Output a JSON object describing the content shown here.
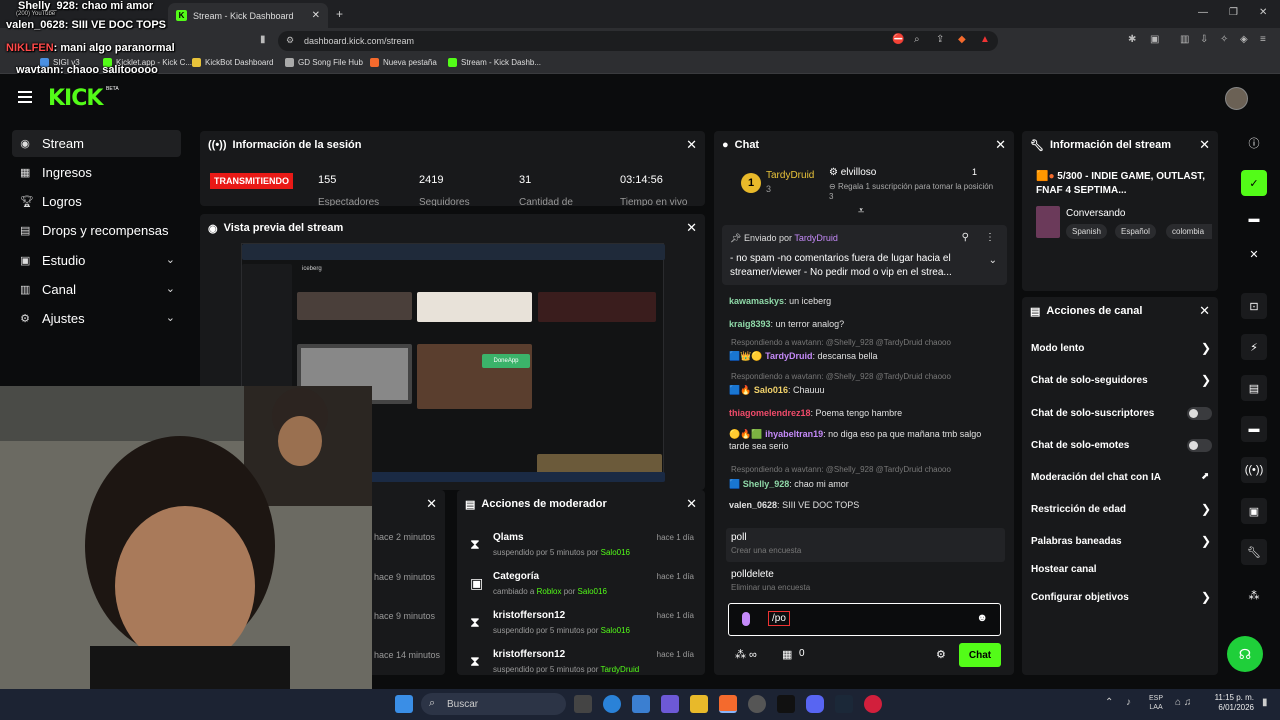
{
  "browser": {
    "tab_title": "Stream - Kick Dashboard",
    "url": "dashboard.kick.com/stream",
    "bookmarks": [
      "SIGI v3",
      "Kicklet.app - Kick C...",
      "KickBot Dashboard",
      "GD Song File Hub",
      "Nueva pestaña",
      "Stream - Kick Dashb..."
    ]
  },
  "overlay_chat": [
    {
      "user": "Shelly_928",
      "text": "chao mi amor",
      "sub": "(200) YouTube"
    },
    {
      "user": "valen_0628",
      "text": "SIII VE DOC TOPS"
    },
    {
      "user": "NIKLFEN",
      "text": "mani algo paranormal"
    },
    {
      "user": "wavtann",
      "text": "chaoo salitooooo"
    }
  ],
  "header": {
    "logo": "KICK",
    "beta": "BETA"
  },
  "sidebar": {
    "items": [
      {
        "label": "Stream",
        "icon": "stream-icon"
      },
      {
        "label": "Ingresos",
        "icon": "revenue-icon"
      },
      {
        "label": "Logros",
        "icon": "trophy-icon"
      },
      {
        "label": "Drops y recompensas",
        "icon": "gift-icon"
      },
      {
        "label": "Estudio",
        "icon": "studio-icon"
      },
      {
        "label": "Canal",
        "icon": "channel-icon"
      },
      {
        "label": "Ajustes",
        "icon": "gear-icon"
      }
    ]
  },
  "session": {
    "title": "Información de la sesión",
    "live_badge": "TRANSMITIENDO",
    "stats": [
      {
        "value": "155",
        "label": "Espectadores"
      },
      {
        "value": "2419",
        "label": "Seguidores"
      },
      {
        "value": "31",
        "label": "Cantidad de"
      },
      {
        "value": "03:14:56",
        "label": "Tiempo en vivo"
      }
    ]
  },
  "preview": {
    "title": "Vista previa del stream",
    "inner_labels": [
      "iceberg",
      "DoneApp"
    ]
  },
  "chat": {
    "title": "Chat",
    "leader": {
      "name": "TardyDruid",
      "rank": "1",
      "sub_count": "3"
    },
    "gifter": {
      "name": "elvilloso",
      "count": "1",
      "desc": "Regala 1 suscripción para tomar la posición 3"
    },
    "pinned": {
      "sent_by": "Enviado por",
      "user": "TardyDruid",
      "text": "- no spam -no comentarios fuera de lugar hacia el streamer/viewer - No pedir mod o vip en el strea..."
    },
    "messages": [
      {
        "user": "kawamaskys",
        "text": "un iceberg",
        "color": "#8fd9a8"
      },
      {
        "user": "kraig8393",
        "text": "un terror analog?",
        "color": "#8fd9a8"
      },
      {
        "reply": "Respondiendo a wavtann: @Shelly_928 @TardyDruid chaooo",
        "user": "TardyDruid",
        "text": "descansa bella",
        "color": "#c58af9"
      },
      {
        "reply": "Respondiendo a wavtann: @Shelly_928 @TardyDruid chaooo",
        "user": "Salo016",
        "text": "Chauuu",
        "color": "#f3d36b"
      },
      {
        "user": "thiagomelendrez18",
        "text": "Poema tengo hambre",
        "color": "#f04b6a"
      },
      {
        "user": "ihyabeltran19",
        "text": "no diga eso pa que mañana tmb salgo tarde sea serio",
        "color": "#c58af9"
      },
      {
        "reply": "Respondiendo a wavtann: @Shelly_928 @TardyDruid chaooo",
        "user": "Shelly_928",
        "text": "chao mi amor",
        "color": "#8fd9a8"
      },
      {
        "user": "valen_0628",
        "text": "SIII VE DOC TOPS",
        "color": "#e8e8e8"
      }
    ],
    "suggestions": [
      {
        "cmd": "poll",
        "desc": "Crear una encuesta"
      },
      {
        "cmd": "polldelete",
        "desc": "Eliminar una encuesta"
      }
    ],
    "input_value": "/po",
    "send_label": "Chat",
    "points": "0"
  },
  "stream_info": {
    "title": "Información del stream",
    "stream_title": "5/300 - INDIE GAME, OUTLAST, FNAF 4 SEPTIMA...",
    "category": "Conversando",
    "tags": [
      "Spanish",
      "Español",
      "colombia"
    ]
  },
  "channel_actions": {
    "title": "Acciones de canal",
    "items": [
      {
        "label": "Modo lento",
        "control": "arrow"
      },
      {
        "label": "Chat de solo-seguidores",
        "control": "arrow"
      },
      {
        "label": "Chat de solo-suscriptores",
        "control": "toggle"
      },
      {
        "label": "Chat de solo-emotes",
        "control": "toggle"
      },
      {
        "label": "Moderación del chat con IA",
        "control": "external"
      },
      {
        "label": "Restricción de edad",
        "control": "arrow"
      },
      {
        "label": "Palabras baneadas",
        "control": "arrow"
      },
      {
        "label": "Hostear canal",
        "control": "none"
      },
      {
        "label": "Configurar objetivos",
        "control": "arrow"
      }
    ]
  },
  "mod_actions": {
    "title": "Acciones de moderador",
    "items": [
      {
        "name": "Qlams",
        "desc": "suspendido por 5 minutos por",
        "by": "Salo016",
        "time": "hace 1 día",
        "icon": "hourglass-icon"
      },
      {
        "name": "Categoría",
        "desc": "cambiado a",
        "target": "Roblox",
        "desc2": "por",
        "by": "Salo016",
        "time": "hace 1 día",
        "icon": "category-icon"
      },
      {
        "name": "kristofferson12",
        "desc": "suspendido por 5 minutos por",
        "by": "Salo016",
        "time": "hace 1 día",
        "icon": "hourglass-icon"
      },
      {
        "name": "kristofferson12",
        "desc": "suspendido por 5 minutos por",
        "by": "TardyDruid",
        "time": "hace 1 día",
        "icon": "hourglass-icon"
      }
    ]
  },
  "left_hidden_panel": {
    "times": [
      "hace 2 minutos",
      "hace 9 minutos",
      "hace 9 minutos",
      "hace 14 minutos"
    ]
  },
  "taskbar": {
    "search": "Buscar",
    "lang": "ESP",
    "lang2": "LAA",
    "time": "11:15 p. m.",
    "date": "6/01/2026"
  },
  "colors": {
    "accent": "#53fc18",
    "live": "#e91916",
    "panel": "#18191b",
    "bg": "#0b0c0d"
  }
}
